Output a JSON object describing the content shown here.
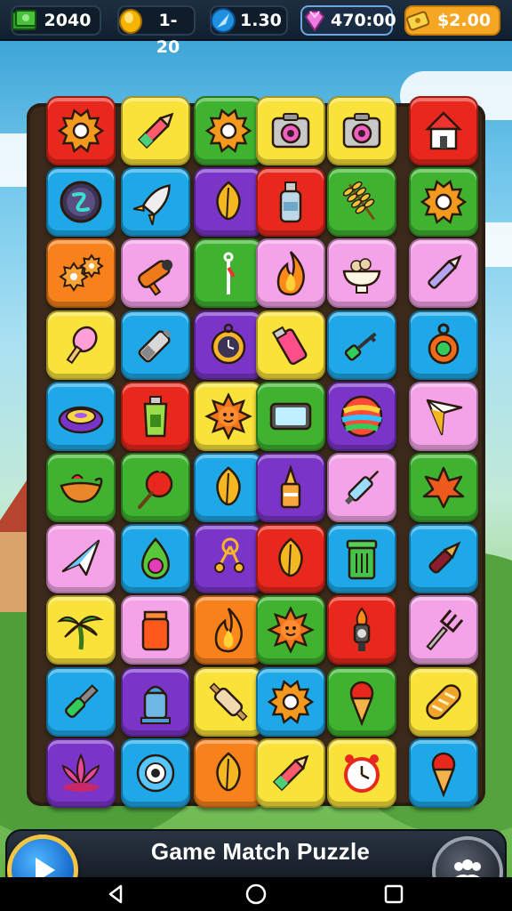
{
  "resources": [
    {
      "label": "2040",
      "icon": "green-banknote-icon"
    },
    {
      "label": "1-20",
      "icon": "gold-coin-icon"
    },
    {
      "label": "1.30",
      "icon": "blue-feather-icon"
    },
    {
      "label": "470:00",
      "icon": "pink-gem-icon"
    },
    {
      "label": "$2.00",
      "icon": "gold-ticket-icon"
    }
  ],
  "title": "Game Match Puzzle",
  "colors": {
    "red": "#e8281c",
    "yellow": "#f9e23a",
    "green": "#3fb230",
    "blue": "#1ea8e8",
    "purple": "#7a35c8",
    "pink": "#f4a3e8",
    "orange": "#f7821c"
  },
  "board": {
    "rows": 10,
    "cols": 6,
    "tiles": [
      [
        {
          "c": "red",
          "i": "gear-icon"
        },
        {
          "c": "yellow",
          "i": "pencil-icon"
        },
        {
          "c": "green",
          "i": "gear-icon"
        },
        {
          "c": "yellow",
          "i": "camera-icon"
        },
        {
          "c": "yellow",
          "i": "camera-icon"
        },
        {
          "c": "red",
          "i": "house-icon"
        }
      ],
      [
        {
          "c": "blue",
          "i": "compass-icon"
        },
        {
          "c": "blue",
          "i": "rocket-icon"
        },
        {
          "c": "purple",
          "i": "leaf-icon"
        },
        {
          "c": "red",
          "i": "bottle-icon"
        },
        {
          "c": "green",
          "i": "wheat-icon"
        },
        {
          "c": "green",
          "i": "gear-icon"
        }
      ],
      [
        {
          "c": "orange",
          "i": "gears-icon"
        },
        {
          "c": "pink",
          "i": "pipe-icon"
        },
        {
          "c": "green",
          "i": "cane-icon"
        },
        {
          "c": "pink",
          "i": "flame-icon"
        },
        {
          "c": "pink",
          "i": "food-bowl-icon"
        },
        {
          "c": "pink",
          "i": "pen-icon"
        }
      ],
      [
        {
          "c": "yellow",
          "i": "ice-cream-icon"
        },
        {
          "c": "blue",
          "i": "battery-icon"
        },
        {
          "c": "purple",
          "i": "pocket-watch-icon"
        },
        {
          "c": "yellow",
          "i": "lighter-icon"
        },
        {
          "c": "blue",
          "i": "key-icon"
        },
        {
          "c": "blue",
          "i": "amulet-icon"
        }
      ],
      [
        {
          "c": "blue",
          "i": "dish-icon"
        },
        {
          "c": "red",
          "i": "paint-tube-icon"
        },
        {
          "c": "yellow",
          "i": "sun-icon"
        },
        {
          "c": "green",
          "i": "tablet-icon"
        },
        {
          "c": "purple",
          "i": "ball-icon"
        },
        {
          "c": "pink",
          "i": "arrow-icon"
        }
      ],
      [
        {
          "c": "green",
          "i": "gravy-boat-icon"
        },
        {
          "c": "green",
          "i": "apple-icon"
        },
        {
          "c": "blue",
          "i": "leaf-icon"
        },
        {
          "c": "purple",
          "i": "glue-icon"
        },
        {
          "c": "pink",
          "i": "syringe-icon"
        },
        {
          "c": "green",
          "i": "maple-leaf-icon"
        }
      ],
      [
        {
          "c": "pink",
          "i": "paper-plane-icon"
        },
        {
          "c": "blue",
          "i": "potion-icon"
        },
        {
          "c": "purple",
          "i": "molecule-icon"
        },
        {
          "c": "red",
          "i": "leaf-icon"
        },
        {
          "c": "blue",
          "i": "trash-can-icon"
        },
        {
          "c": "blue",
          "i": "fountain-pen-icon"
        }
      ],
      [
        {
          "c": "yellow",
          "i": "palm-tree-icon"
        },
        {
          "c": "pink",
          "i": "jar-icon"
        },
        {
          "c": "orange",
          "i": "flame-icon"
        },
        {
          "c": "green",
          "i": "sun-icon"
        },
        {
          "c": "red",
          "i": "torch-icon"
        },
        {
          "c": "pink",
          "i": "fork-icon"
        }
      ],
      [
        {
          "c": "blue",
          "i": "chisel-icon"
        },
        {
          "c": "purple",
          "i": "hydrant-icon"
        },
        {
          "c": "yellow",
          "i": "rolling-pin-icon"
        },
        {
          "c": "blue",
          "i": "gear-icon"
        },
        {
          "c": "green",
          "i": "ice-cream-cone-icon"
        },
        {
          "c": "yellow",
          "i": "bread-icon"
        }
      ],
      [
        {
          "c": "purple",
          "i": "lotus-icon"
        },
        {
          "c": "blue",
          "i": "eye-icon"
        },
        {
          "c": "orange",
          "i": "leaf-icon"
        },
        {
          "c": "yellow",
          "i": "pencil-icon"
        },
        {
          "c": "yellow",
          "i": "alarm-clock-icon"
        },
        {
          "c": "blue",
          "i": "ice-cream-cone-icon"
        }
      ]
    ]
  },
  "nav": [
    "back-icon",
    "home-icon",
    "recents-icon"
  ]
}
